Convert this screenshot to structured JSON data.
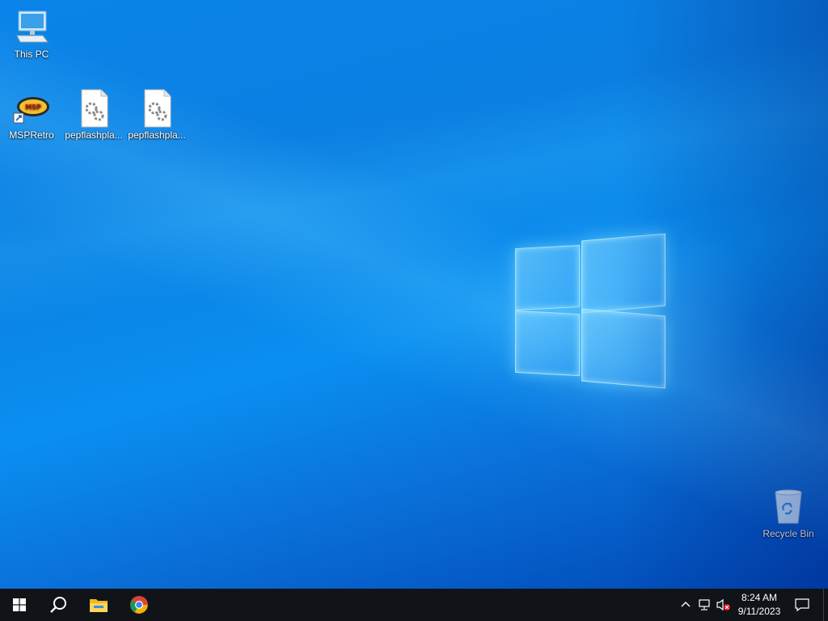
{
  "desktop": {
    "icons": [
      {
        "label": "This PC",
        "icon": "computer-icon"
      },
      {
        "label": "MSPRetro",
        "icon": "msp-logo-icon"
      },
      {
        "label": "pepflashpla...",
        "icon": "settings-file-icon"
      },
      {
        "label": "pepflashpla...",
        "icon": "settings-file-icon"
      },
      {
        "label": "Recycle Bin",
        "icon": "recycle-bin-icon"
      }
    ]
  },
  "taskbar": {
    "start": "windows-start-icon",
    "search": "search-icon",
    "pinned": [
      "file-explorer-icon",
      "chrome-icon"
    ],
    "tray": {
      "chevron": "show-hidden-icons-chevron",
      "network": "network-icon",
      "volume": "volume-muted-icon",
      "time": "8:24 AM",
      "date": "9/11/2023",
      "notifications": "notification-icon"
    }
  },
  "colors": {
    "taskbar_bg": "#101418",
    "desktop_blue": "#0a84e8"
  }
}
